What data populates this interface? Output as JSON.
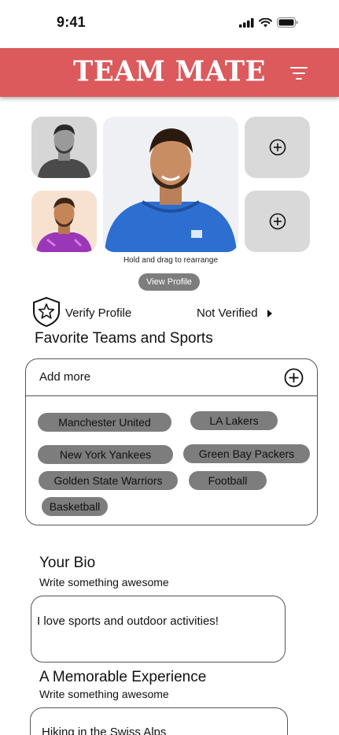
{
  "status_bar": {
    "time": "9:41"
  },
  "header": {
    "title": "TEAM MATE",
    "accent_color": "#dc595c"
  },
  "photos": {
    "hint": "Hold and drag to rearrange",
    "view_profile_label": "View Profile"
  },
  "verify": {
    "label": "Verify Profile",
    "status": "Not Verified"
  },
  "favorites": {
    "title": "Favorite Teams and Sports",
    "add_more_label": "Add more",
    "chips": [
      "Manchester United",
      "LA Lakers",
      "New York Yankees",
      "Green Bay Packers",
      "Golden State Warriors",
      "Football",
      "Basketball"
    ]
  },
  "bio": {
    "title": "Your Bio",
    "subtitle": "Write something awesome",
    "value": "I love sports and outdoor activities!"
  },
  "experience": {
    "title": "A Memorable Experience",
    "subtitle": "Write something awesome",
    "value": "Hiking in the Swiss Alps"
  }
}
